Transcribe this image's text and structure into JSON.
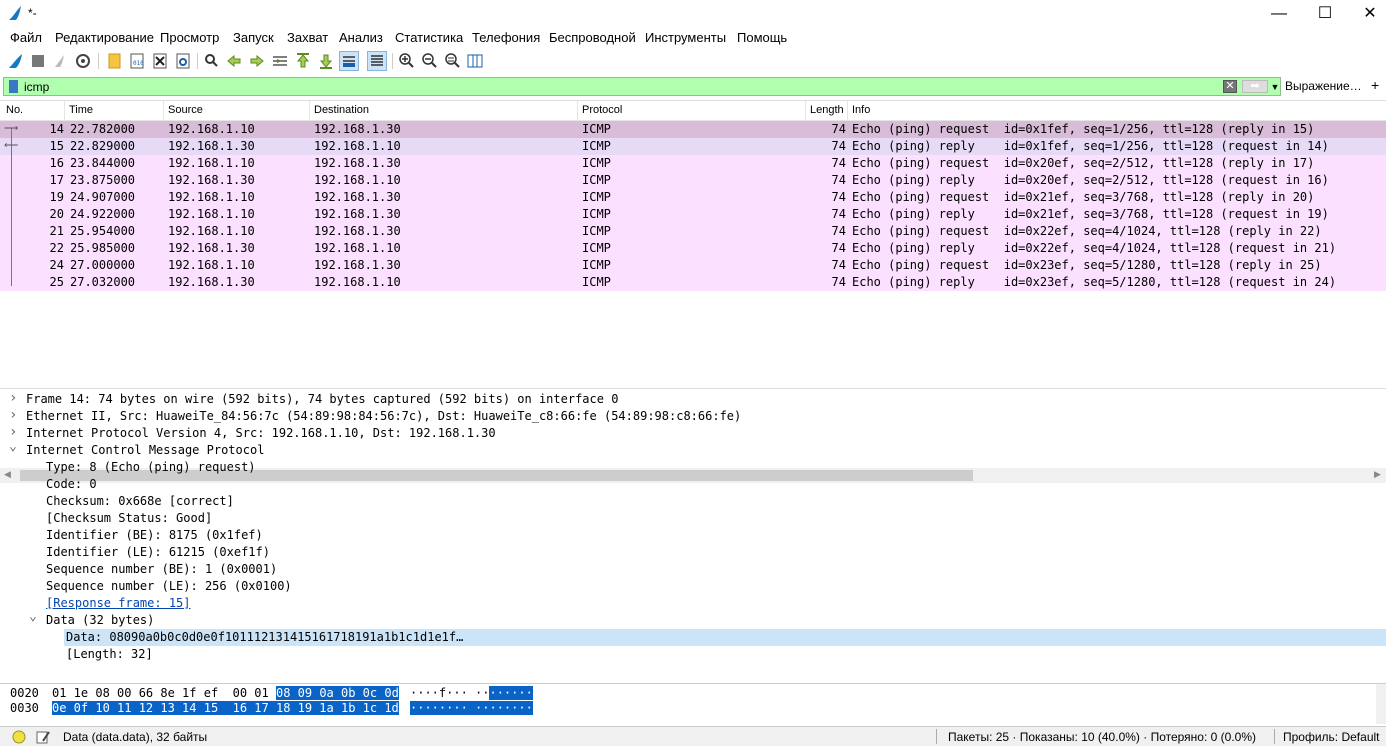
{
  "window": {
    "title": "*-"
  },
  "menu": [
    "Файл",
    "Редактирование",
    "Просмотр",
    "Запуск",
    "Захват",
    "Анализ",
    "Статистика",
    "Телефония",
    "Беспроводной",
    "Инструменты",
    "Помощь"
  ],
  "filter": {
    "value": "icmp",
    "expression_button": "Выражение…",
    "add_button": "+"
  },
  "columns": [
    "No.",
    "Time",
    "Source",
    "Destination",
    "Protocol",
    "Length",
    "Info"
  ],
  "packets": [
    {
      "no": "14",
      "time": "22.782000",
      "src": "192.168.1.10",
      "dst": "192.168.1.30",
      "proto": "ICMP",
      "len": "74",
      "info": "Echo (ping) request  id=0x1fef, seq=1/256, ttl=128 (reply in 15)",
      "state": "selected"
    },
    {
      "no": "15",
      "time": "22.829000",
      "src": "192.168.1.30",
      "dst": "192.168.1.10",
      "proto": "ICMP",
      "len": "74",
      "info": "Echo (ping) reply    id=0x1fef, seq=1/256, ttl=128 (request in 14)",
      "state": "related"
    },
    {
      "no": "16",
      "time": "23.844000",
      "src": "192.168.1.10",
      "dst": "192.168.1.30",
      "proto": "ICMP",
      "len": "74",
      "info": "Echo (ping) request  id=0x20ef, seq=2/512, ttl=128 (reply in 17)",
      "state": "normal"
    },
    {
      "no": "17",
      "time": "23.875000",
      "src": "192.168.1.30",
      "dst": "192.168.1.10",
      "proto": "ICMP",
      "len": "74",
      "info": "Echo (ping) reply    id=0x20ef, seq=2/512, ttl=128 (request in 16)",
      "state": "normal"
    },
    {
      "no": "19",
      "time": "24.907000",
      "src": "192.168.1.10",
      "dst": "192.168.1.30",
      "proto": "ICMP",
      "len": "74",
      "info": "Echo (ping) request  id=0x21ef, seq=3/768, ttl=128 (reply in 20)",
      "state": "normal"
    },
    {
      "no": "20",
      "time": "24.922000",
      "src": "192.168.1.10",
      "dst": "192.168.1.30",
      "proto": "ICMP",
      "len": "74",
      "info": "Echo (ping) reply    id=0x21ef, seq=3/768, ttl=128 (request in 19)",
      "state": "normal"
    },
    {
      "no": "21",
      "time": "25.954000",
      "src": "192.168.1.10",
      "dst": "192.168.1.30",
      "proto": "ICMP",
      "len": "74",
      "info": "Echo (ping) request  id=0x22ef, seq=4/1024, ttl=128 (reply in 22)",
      "state": "normal"
    },
    {
      "no": "22",
      "time": "25.985000",
      "src": "192.168.1.30",
      "dst": "192.168.1.10",
      "proto": "ICMP",
      "len": "74",
      "info": "Echo (ping) reply    id=0x22ef, seq=4/1024, ttl=128 (request in 21)",
      "state": "normal"
    },
    {
      "no": "24",
      "time": "27.000000",
      "src": "192.168.1.10",
      "dst": "192.168.1.30",
      "proto": "ICMP",
      "len": "74",
      "info": "Echo (ping) request  id=0x23ef, seq=5/1280, ttl=128 (reply in 25)",
      "state": "normal"
    },
    {
      "no": "25",
      "time": "27.032000",
      "src": "192.168.1.30",
      "dst": "192.168.1.10",
      "proto": "ICMP",
      "len": "74",
      "info": "Echo (ping) reply    id=0x23ef, seq=5/1280, ttl=128 (request in 24)",
      "state": "normal"
    }
  ],
  "details": [
    {
      "text": "Frame 14: 74 bytes on wire (592 bits), 74 bytes captured (592 bits) on interface 0",
      "level": 0,
      "expander": "collapsed"
    },
    {
      "text": "Ethernet II, Src: HuaweiTe_84:56:7c (54:89:98:84:56:7c), Dst: HuaweiTe_c8:66:fe (54:89:98:c8:66:fe)",
      "level": 0,
      "expander": "collapsed"
    },
    {
      "text": "Internet Protocol Version 4, Src: 192.168.1.10, Dst: 192.168.1.30",
      "level": 0,
      "expander": "collapsed"
    },
    {
      "text": "Internet Control Message Protocol",
      "level": 0,
      "expander": "expanded"
    },
    {
      "text": "Type: 8 (Echo (ping) request)",
      "level": 1,
      "expander": "none"
    },
    {
      "text": "Code: 0",
      "level": 1,
      "expander": "none"
    },
    {
      "text": "Checksum: 0x668e [correct]",
      "level": 1,
      "expander": "none"
    },
    {
      "text": "[Checksum Status: Good]",
      "level": 1,
      "expander": "none"
    },
    {
      "text": "Identifier (BE): 8175 (0x1fef)",
      "level": 1,
      "expander": "none"
    },
    {
      "text": "Identifier (LE): 61215 (0xef1f)",
      "level": 1,
      "expander": "none"
    },
    {
      "text": "Sequence number (BE): 1 (0x0001)",
      "level": 1,
      "expander": "none"
    },
    {
      "text": "Sequence number (LE): 256 (0x0100)",
      "level": 1,
      "expander": "none"
    },
    {
      "text": "[Response frame: 15]",
      "level": 1,
      "expander": "none",
      "link": true
    },
    {
      "text": "Data (32 bytes)",
      "level": 1,
      "expander": "expanded"
    },
    {
      "text": "Data: 08090a0b0c0d0e0f101112131415161718191a1b1c1d1e1f…",
      "level": 2,
      "expander": "none",
      "selected": true
    },
    {
      "text": "[Length: 32]",
      "level": 2,
      "expander": "none"
    }
  ],
  "bytes": [
    {
      "offset": "0020",
      "hex_plain": "01 1e 08 00 66 8e 1f ef  00 01 ",
      "hex_hl": "08 09 0a 0b 0c 0d",
      "ascii_plain": "····f··· ··",
      "ascii_hl": "······"
    },
    {
      "offset": "0030",
      "hex_plain": "",
      "hex_hl": "0e 0f 10 11 12 13 14 15  16 17 18 19 1a 1b 1c 1d",
      "ascii_plain": "",
      "ascii_hl": "········ ········"
    }
  ],
  "status": {
    "field": "Data (data.data), 32 байты",
    "packets": "Пакеты: 25 · Показаны: 10 (40.0%) · Потеряно: 0 (0.0%)",
    "profile": "Профиль: Default"
  },
  "colors": {
    "selected": "#d8bcd8",
    "related": "#e7daf7",
    "icmp": "#fce0ff",
    "filter_ok": "#afffaf",
    "highlight": "#0a64c8"
  }
}
